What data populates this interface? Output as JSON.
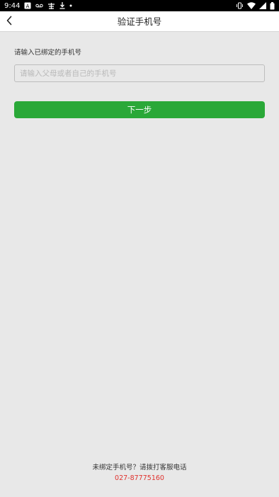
{
  "status_bar": {
    "time": "9:44",
    "left_icons": [
      "notification-a-icon",
      "voicemail-icon",
      "app-notification-icon",
      "download-icon",
      "dot-icon"
    ],
    "right_icons": [
      "vibrate-icon",
      "wifi-icon",
      "signal-icon",
      "battery-icon"
    ]
  },
  "header": {
    "title": "验证手机号",
    "back_icon": "chevron-left-icon"
  },
  "form": {
    "label": "请输入已绑定的手机号",
    "phone_placeholder": "请输入父母或者自己的手机号",
    "phone_value": "",
    "next_label": "下一步"
  },
  "footer": {
    "note": "未绑定手机号？请拨打客服电话",
    "phone": "027-87775160"
  },
  "colors": {
    "primary": "#2aa838",
    "phone_link": "#e0322e",
    "background": "#e8e8e8",
    "header_bg": "#ffffff",
    "status_bar_bg": "#000000"
  }
}
